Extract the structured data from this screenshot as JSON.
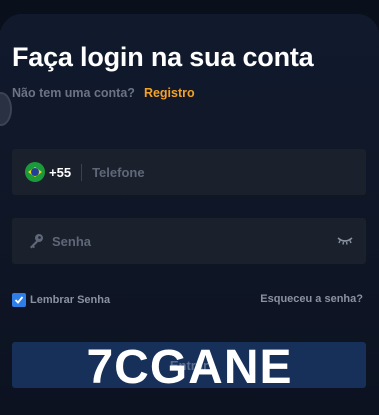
{
  "header": {
    "title": "Faça login na sua conta",
    "no_account": "Não tem uma conta?",
    "register_link": "Registro"
  },
  "phone_field": {
    "country_flag": "brazil-flag",
    "country_code": "+55",
    "placeholder": "Telefone"
  },
  "password_field": {
    "icon": "key-icon",
    "placeholder": "Senha",
    "toggle_icon": "eye-closed-icon"
  },
  "options": {
    "remember_label": "Lembrar Senha",
    "remember_checked": true,
    "forgot_link": "Esqueceu a senha?"
  },
  "submit": {
    "label": "Entrar"
  },
  "watermark": "7CGANE",
  "colors": {
    "background": "#101829",
    "field": "#1a202c",
    "accent": "#f4a126",
    "checkbox": "#2f7ee8",
    "button": "#16305a"
  }
}
